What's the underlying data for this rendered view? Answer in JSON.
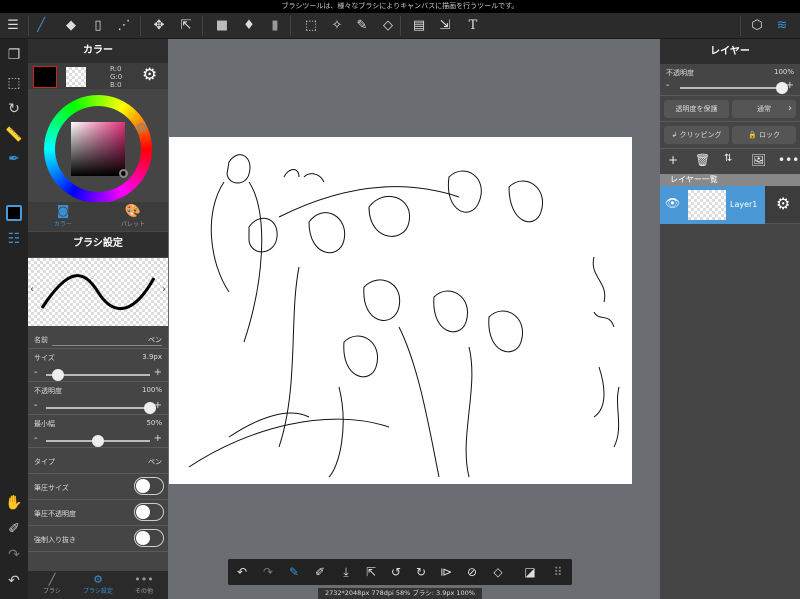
{
  "message": "ブラシツールは、様々なブラシによりキャンバスに描画を行うツールです。",
  "colors": {
    "accent": "#3a8fd0",
    "selected_layer": "#4a98d6",
    "canvas_bg": "#6a6d72"
  },
  "toolbar": {
    "icons": [
      "menu-icon",
      "brush-icon",
      "eraser-icon",
      "rectangle-icon",
      "dot-icon",
      "move-icon",
      "transform-icon",
      "fill-color-icon",
      "bucket-icon",
      "gradient-icon",
      "select-rect-icon",
      "magic-wand-icon",
      "select-pen-icon",
      "select-eraser-icon",
      "frame-divide-icon",
      "operation-icon",
      "text-icon",
      "material-icon",
      "layers-icon"
    ]
  },
  "color_panel": {
    "title": "カラー",
    "r": "R:0",
    "g": "G:0",
    "b": "B:0",
    "tab_color": "カラー",
    "tab_palette": "パレット",
    "primary": "#000000"
  },
  "brush_panel": {
    "title": "ブラシ設定",
    "name_label": "名前",
    "name_value": "ペン",
    "size_label": "サイズ",
    "size_value": "3.9px",
    "size_fraction": 0.12,
    "opacity_label": "不透明度",
    "opacity_value": "100%",
    "opacity_fraction": 1.0,
    "min_width_label": "最小幅",
    "min_width_value": "50%",
    "min_width_fraction": 0.5,
    "type_label": "タイプ",
    "type_value": "ペン",
    "pressure_size": "筆圧サイズ",
    "pressure_opacity": "筆圧不透明度",
    "force_taper": "強制入り抜き",
    "tabs": [
      "ブラシ",
      "ブラシ設定",
      "その他"
    ],
    "minus": "-",
    "plus": "+"
  },
  "layer_panel": {
    "title": "レイヤー",
    "opacity_label": "不透明度",
    "opacity_value": "100%",
    "protect_alpha": "透明度を保護",
    "blend_mode": "通常",
    "clipping": "クリッピング",
    "lock": "ロック",
    "list_title": "レイヤー一覧",
    "layers": [
      {
        "name": "Layer1",
        "visible": true,
        "selected": true
      }
    ]
  },
  "status": "2732*2048px 778dpi 58% ブラシ: 3.9px 100%"
}
